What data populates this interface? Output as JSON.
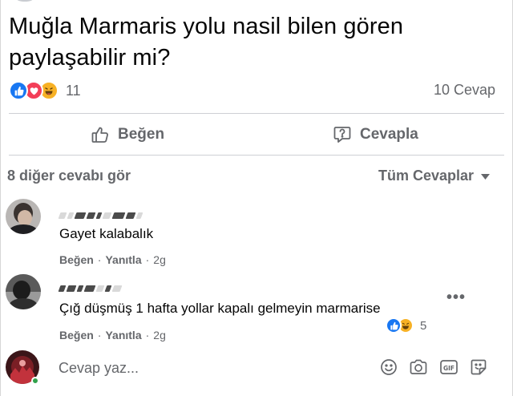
{
  "question": {
    "text": "Muğla Marmaris yolu nasil bilen gören paylaşabilir mi?"
  },
  "reactions": {
    "icons": [
      "like-icon",
      "love-icon",
      "haha-icon"
    ],
    "count": "11",
    "answers": "10 Cevap"
  },
  "actions": {
    "like_label": "Beğen",
    "reply_label": "Cevapla"
  },
  "comments_header": {
    "more_label": "8 diğer cevabı gör",
    "filter_label": "Tüm Cevaplar"
  },
  "comments": [
    {
      "text": "Gayet kalabalık",
      "like_label": "Beğen",
      "reply_label": "Yanıtla",
      "time": "2g"
    },
    {
      "text": "Çığ düşmüş 1 hafta yollar kapalı gelmeyin marmarise",
      "like_label": "Beğen",
      "reply_label": "Yanıtla",
      "time": "2g",
      "reaction_count": "5",
      "reaction_icons": [
        "like-icon",
        "haha-icon"
      ]
    }
  ],
  "composer": {
    "placeholder": "Cevap yaz...",
    "icons": [
      "emoji-icon",
      "camera-icon",
      "gif-icon",
      "sticker-icon"
    ]
  },
  "colors": {
    "like_blue": "#1877f2",
    "love_red": "#f33e58",
    "haha_yellow": "#f7b125",
    "secondary_text": "#65676b",
    "online_green": "#31a24c"
  }
}
